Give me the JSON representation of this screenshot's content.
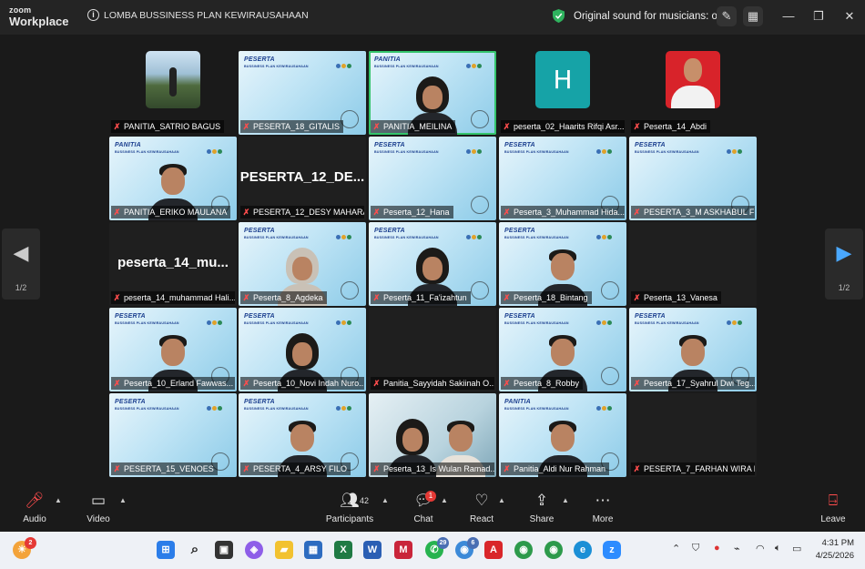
{
  "titlebar": {
    "brand_top": "zoom",
    "brand_bottom": "Workplace",
    "meeting_title": "LOMBA BUSSINESS PLAN KEWIRAUSAHAAN",
    "sound_status": "Original sound for musicians: on"
  },
  "gallery": {
    "page_left": "1/2",
    "page_right": "1/2",
    "poster_title_a": "PESERTA",
    "poster_title_b": "PANITIA",
    "poster_sub": "BUSSINESS PLAN KEWIRAUSAHAAN",
    "row1": {
      "t1": "PANITIA_SATRIO BAGUS",
      "t2": "PESERTA_18_GITALIS",
      "t3": "PANITIA_MEILINA",
      "t4": "peserta_02_Haarits Rifqi Asr...",
      "t4_letter": "H",
      "t5": "Peserta_14_Abdi"
    },
    "row2": {
      "t1": "PANITIA_ERIKO MAULANA",
      "t2": "PESERTA_12_DESY MAHARA...",
      "t2_big": "PESERTA_12_DE...",
      "t3": "Peserta_12_Hana",
      "t4": "Peserta_3_Muhammad Hida...",
      "t5": "PESERTA_3_M ASKHABUL FIR..."
    },
    "row3": {
      "t1": "peserta_14_muhammad Hali...",
      "t1_big": "peserta_14_mu...",
      "t2": "Peserta_8_Agdeka",
      "t3": "Peserta_11_Fa'izahtun",
      "t4": "Peserta_18_Bintang",
      "t5": "Peserta_13_Vanesa"
    },
    "row4": {
      "t1": "Peserta_10_Erland Fawwas...",
      "t2": "Peserta_10_Novi Indah Nuro...",
      "t3": "Panitia_Sayyidah Sakiinah O...",
      "t4": "Peserta_8_Robby",
      "t5": "Peserta_17_Syahrul Dwi Teg..."
    },
    "row5": {
      "t1": "PESERTA_15_VENOES",
      "t2": "PESERTA_4_ARSY FILO",
      "t3": "Peserta_13_Is Wulan Ramad...",
      "t4": "Panitia_Aldi Nur Rahman",
      "t5": "PESERTA_7_FARHAN WIRA P..."
    }
  },
  "toolbar": {
    "audio": "Audio",
    "video": "Video",
    "participants": "Participants",
    "participants_count": "42",
    "chat": "Chat",
    "chat_badge": "1",
    "react": "React",
    "share": "Share",
    "more": "More",
    "leave": "Leave"
  },
  "taskbar": {
    "weather_badge": "2",
    "whatsapp_badge": "29",
    "chrome_badge": "6",
    "time": "4:31 PM",
    "date": "4/25/2026"
  },
  "colors": {
    "accent_green": "#33c46b",
    "muted_red": "#ff4d4d",
    "nav_blue": "#4aa8ff"
  }
}
